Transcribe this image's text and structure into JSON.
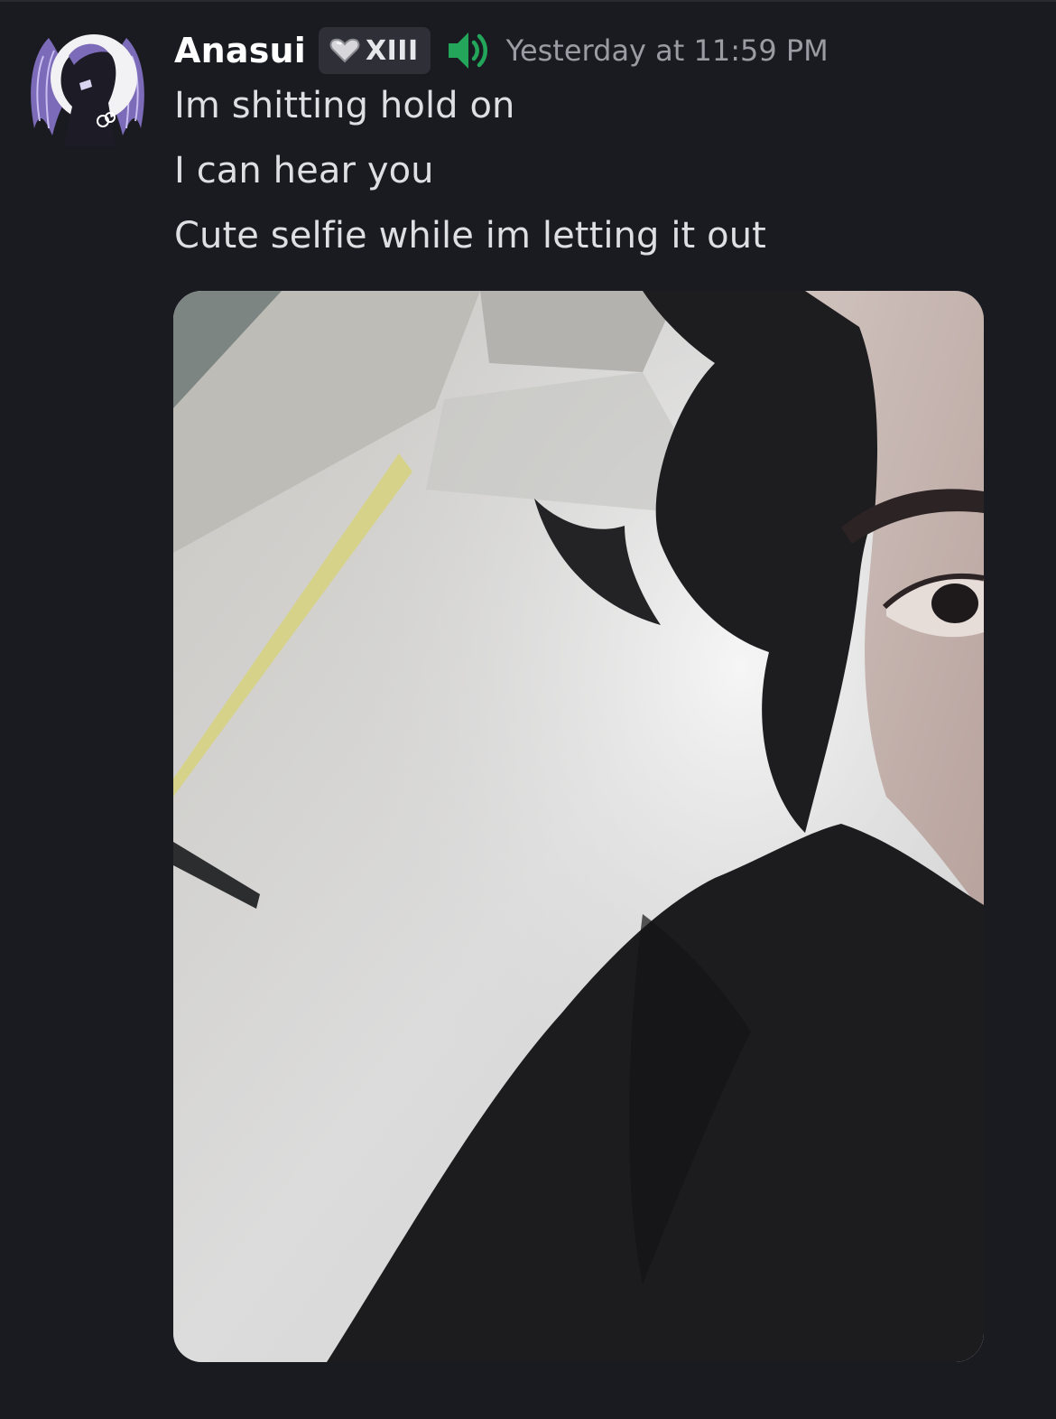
{
  "message": {
    "author": {
      "name": "Anasui",
      "avatar_icon": "angel-wings-avatar-icon",
      "badge": {
        "icon": "heart-icon",
        "label": "XIII"
      },
      "voice_status_icon": "speaker-volume-icon",
      "voice_status_color": "#23a55a"
    },
    "timestamp": "Yesterday at 11:59 PM",
    "lines": [
      "Im shitting hold on",
      "I can hear you",
      "Cute selfie while im letting it out"
    ],
    "attachment": {
      "type": "image",
      "subject": "selfie-photo"
    }
  },
  "theme": {
    "background": "#1a1b20",
    "text": "#dedfe3",
    "muted": "#9b9ca3",
    "badge_bg": "#2f3037"
  }
}
